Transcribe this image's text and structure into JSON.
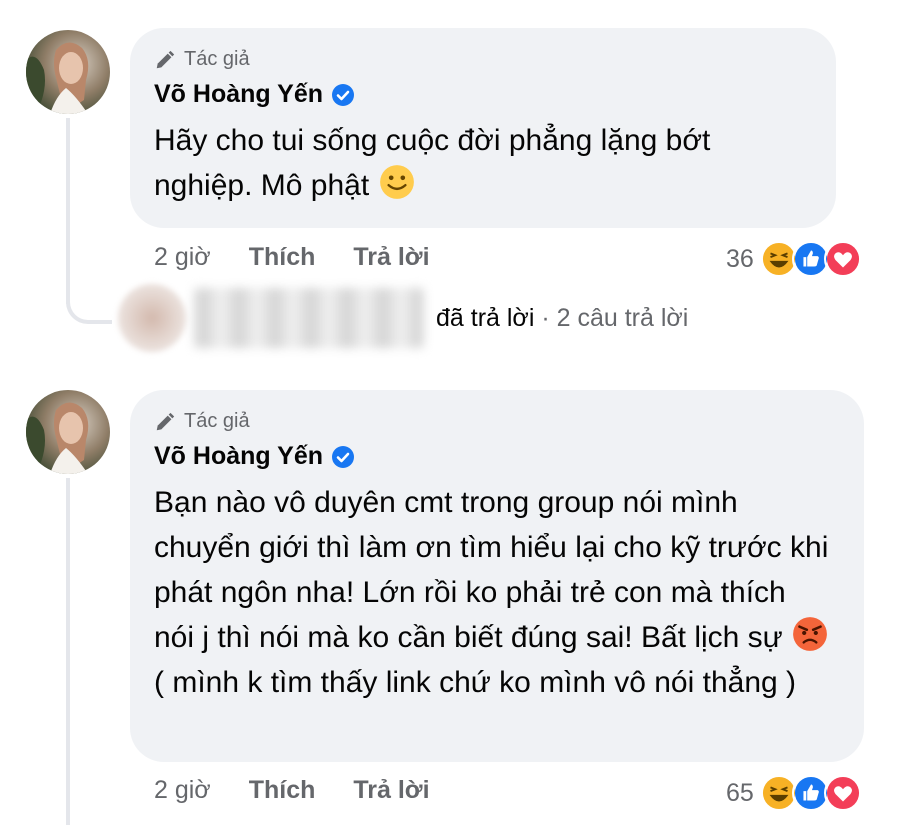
{
  "comments": [
    {
      "author_badge": "Tác giả",
      "author_name": "Võ Hoàng Yến",
      "text": "Hãy cho tui sống cuộc đời phẳng lặng bớt nghiệp. Mô phật",
      "emoji": "slightly-smiling-face",
      "time": "2 giờ",
      "like_label": "Thích",
      "reply_label": "Trả lời",
      "reaction_count": "36",
      "reactions": [
        "haha",
        "like",
        "love"
      ]
    },
    {
      "author_badge": "Tác giả",
      "author_name": "Võ Hoàng Yến",
      "text_before_emoji": "Bạn nào vô duyên cmt trong group nói mình chuyển giới thì làm ơn tìm hiểu lại cho kỹ trước khi phát ngôn nha! Lớn rồi ko phải trẻ con mà thích nói j thì nói mà ko cần biết đúng sai! Bất lịch sự",
      "emoji": "angry-face",
      "text_after_emoji": "( mình k tìm thấy link chứ ko mình vô nói thẳng )",
      "time": "2 giờ",
      "like_label": "Thích",
      "reply_label": "Trả lời",
      "reaction_count": "65",
      "reactions": [
        "haha",
        "like",
        "love"
      ]
    }
  ],
  "reply_summary": {
    "action_text": "đã trả lời",
    "separator": "·",
    "count_text": "2 câu trả lời"
  },
  "colors": {
    "bubble": "#f0f2f5",
    "secondary_text": "#65676b",
    "verified": "#1877f2",
    "like": "#1877f2",
    "love": "#f33e58",
    "haha": "#f7b125"
  }
}
